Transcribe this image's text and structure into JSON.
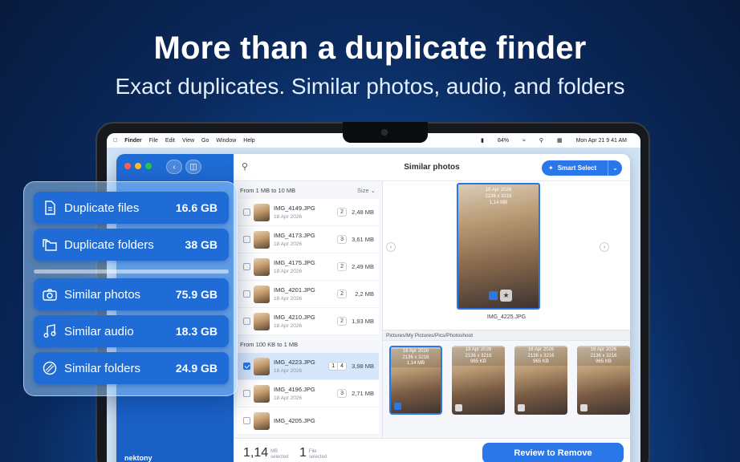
{
  "hero": {
    "headline": "More than a duplicate finder",
    "subline": "Exact duplicates. Similar photos, audio, and folders"
  },
  "menubar": {
    "items": [
      "Finder",
      "File",
      "Edit",
      "View",
      "Go",
      "Window",
      "Help"
    ],
    "battery": "84%",
    "datetime": "Mon Apr 21  9 41 AM"
  },
  "app": {
    "title": "Similar photos",
    "smart_select_label": "Smart Select",
    "brand": "nektony"
  },
  "categories": [
    {
      "label": "Duplicate files",
      "size": "16.6 GB",
      "icon": "file-icon"
    },
    {
      "label": "Duplicate folders",
      "size": "38 GB",
      "icon": "folders-icon"
    },
    {
      "label": "Similar photos",
      "size": "75.9 GB",
      "icon": "camera-icon"
    },
    {
      "label": "Similar audio",
      "size": "18.3 GB",
      "icon": "music-note-icon"
    },
    {
      "label": "Similar folders",
      "size": "24.9 GB",
      "icon": "similar-folders-icon"
    }
  ],
  "list": {
    "group1_label": "From 1 MB to 10 MB",
    "sort_label": "Size",
    "group2_label": "From 100 KB to 1 MB",
    "group1": [
      {
        "name": "IMG_4149.JPG",
        "date": "18 Apr 2026",
        "count": "2",
        "size": "2,48 MB"
      },
      {
        "name": "IMG_4173.JPG",
        "date": "18 Apr 2026",
        "count": "3",
        "size": "3,61 MB"
      },
      {
        "name": "IMG_4175.JPG",
        "date": "18 Apr 2026",
        "count": "2",
        "size": "2,49 MB"
      },
      {
        "name": "IMG_4201.JPG",
        "date": "18 Apr 2026",
        "count": "2",
        "size": "2,2 MB"
      },
      {
        "name": "IMG_4210.JPG",
        "date": "18 Apr 2026",
        "count": "2",
        "size": "1,93 MB"
      }
    ],
    "group2": [
      {
        "name": "IMG_4223.JPG",
        "date": "18 Apr 2026",
        "count_sel": "1",
        "count": "4",
        "size": "3,98 MB"
      },
      {
        "name": "IMG_4196.JPG",
        "date": "18 Apr 2026",
        "count": "3",
        "size": "2,71 MB"
      },
      {
        "name": "IMG_4205.JPG",
        "date": "",
        "count": "",
        "size": ""
      }
    ]
  },
  "preview": {
    "date": "18 Apr 2026",
    "dims": "2136 x 3216",
    "filesize": "1,14 MB",
    "filename": "IMG_4225.JPG",
    "path": "Pictures/My Pictures/Pics/Photoshoot"
  },
  "gallery": [
    {
      "date": "18 Apr 2026",
      "dims": "2136 x 3216",
      "size": "1,14 MB",
      "selected": true
    },
    {
      "date": "18 Apr 2026",
      "dims": "2136 x 3216",
      "size": "965 KB",
      "selected": false
    },
    {
      "date": "18 Apr 2026",
      "dims": "2136 x 3216",
      "size": "965 KB",
      "selected": false
    },
    {
      "date": "18 Apr 2026",
      "dims": "2136 x 3216",
      "size": "965 KB",
      "selected": false
    }
  ],
  "footer": {
    "size_num": "1,14",
    "size_unit": "MB",
    "size_label": "selected",
    "file_num": "1",
    "file_unit": "File",
    "file_label": "selected",
    "review_label": "Review to Remove"
  }
}
